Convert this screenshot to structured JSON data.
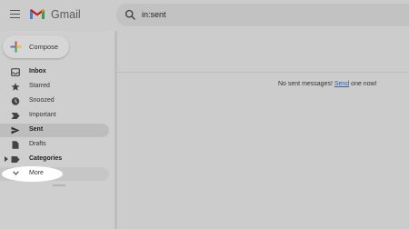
{
  "app": {
    "name": "Gmail"
  },
  "search": {
    "query": "in:sent"
  },
  "compose": {
    "label": "Compose"
  },
  "sidebar": {
    "items": [
      {
        "label": "Inbox",
        "icon": "inbox-icon"
      },
      {
        "label": "Starred",
        "icon": "star-icon"
      },
      {
        "label": "Snoozed",
        "icon": "clock-icon"
      },
      {
        "label": "Important",
        "icon": "important-icon"
      },
      {
        "label": "Sent",
        "icon": "send-icon"
      },
      {
        "label": "Drafts",
        "icon": "draft-icon"
      },
      {
        "label": "Categories",
        "icon": "label-icon"
      },
      {
        "label": "More",
        "icon": "chevron-down-icon"
      }
    ]
  },
  "main": {
    "empty_prefix": "No sent messages! ",
    "empty_link": "Send",
    "empty_suffix": " one now!"
  },
  "colors": {
    "gmail_red": "#c5221f",
    "link": "#3560a8",
    "active_item": "#bdbdbd"
  }
}
